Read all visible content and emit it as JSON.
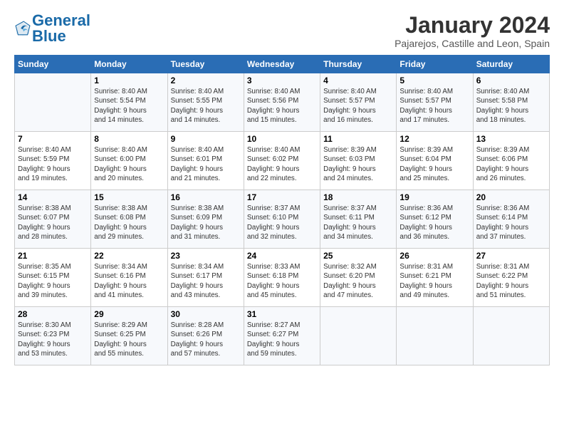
{
  "header": {
    "logo_text_general": "General",
    "logo_text_blue": "Blue",
    "month": "January 2024",
    "location": "Pajarejos, Castille and Leon, Spain"
  },
  "weekdays": [
    "Sunday",
    "Monday",
    "Tuesday",
    "Wednesday",
    "Thursday",
    "Friday",
    "Saturday"
  ],
  "weeks": [
    [
      {
        "day": "",
        "info": ""
      },
      {
        "day": "1",
        "info": "Sunrise: 8:40 AM\nSunset: 5:54 PM\nDaylight: 9 hours\nand 14 minutes."
      },
      {
        "day": "2",
        "info": "Sunrise: 8:40 AM\nSunset: 5:55 PM\nDaylight: 9 hours\nand 14 minutes."
      },
      {
        "day": "3",
        "info": "Sunrise: 8:40 AM\nSunset: 5:56 PM\nDaylight: 9 hours\nand 15 minutes."
      },
      {
        "day": "4",
        "info": "Sunrise: 8:40 AM\nSunset: 5:57 PM\nDaylight: 9 hours\nand 16 minutes."
      },
      {
        "day": "5",
        "info": "Sunrise: 8:40 AM\nSunset: 5:57 PM\nDaylight: 9 hours\nand 17 minutes."
      },
      {
        "day": "6",
        "info": "Sunrise: 8:40 AM\nSunset: 5:58 PM\nDaylight: 9 hours\nand 18 minutes."
      }
    ],
    [
      {
        "day": "7",
        "info": "Sunrise: 8:40 AM\nSunset: 5:59 PM\nDaylight: 9 hours\nand 19 minutes."
      },
      {
        "day": "8",
        "info": "Sunrise: 8:40 AM\nSunset: 6:00 PM\nDaylight: 9 hours\nand 20 minutes."
      },
      {
        "day": "9",
        "info": "Sunrise: 8:40 AM\nSunset: 6:01 PM\nDaylight: 9 hours\nand 21 minutes."
      },
      {
        "day": "10",
        "info": "Sunrise: 8:40 AM\nSunset: 6:02 PM\nDaylight: 9 hours\nand 22 minutes."
      },
      {
        "day": "11",
        "info": "Sunrise: 8:39 AM\nSunset: 6:03 PM\nDaylight: 9 hours\nand 24 minutes."
      },
      {
        "day": "12",
        "info": "Sunrise: 8:39 AM\nSunset: 6:04 PM\nDaylight: 9 hours\nand 25 minutes."
      },
      {
        "day": "13",
        "info": "Sunrise: 8:39 AM\nSunset: 6:06 PM\nDaylight: 9 hours\nand 26 minutes."
      }
    ],
    [
      {
        "day": "14",
        "info": "Sunrise: 8:38 AM\nSunset: 6:07 PM\nDaylight: 9 hours\nand 28 minutes."
      },
      {
        "day": "15",
        "info": "Sunrise: 8:38 AM\nSunset: 6:08 PM\nDaylight: 9 hours\nand 29 minutes."
      },
      {
        "day": "16",
        "info": "Sunrise: 8:38 AM\nSunset: 6:09 PM\nDaylight: 9 hours\nand 31 minutes."
      },
      {
        "day": "17",
        "info": "Sunrise: 8:37 AM\nSunset: 6:10 PM\nDaylight: 9 hours\nand 32 minutes."
      },
      {
        "day": "18",
        "info": "Sunrise: 8:37 AM\nSunset: 6:11 PM\nDaylight: 9 hours\nand 34 minutes."
      },
      {
        "day": "19",
        "info": "Sunrise: 8:36 AM\nSunset: 6:12 PM\nDaylight: 9 hours\nand 36 minutes."
      },
      {
        "day": "20",
        "info": "Sunrise: 8:36 AM\nSunset: 6:14 PM\nDaylight: 9 hours\nand 37 minutes."
      }
    ],
    [
      {
        "day": "21",
        "info": "Sunrise: 8:35 AM\nSunset: 6:15 PM\nDaylight: 9 hours\nand 39 minutes."
      },
      {
        "day": "22",
        "info": "Sunrise: 8:34 AM\nSunset: 6:16 PM\nDaylight: 9 hours\nand 41 minutes."
      },
      {
        "day": "23",
        "info": "Sunrise: 8:34 AM\nSunset: 6:17 PM\nDaylight: 9 hours\nand 43 minutes."
      },
      {
        "day": "24",
        "info": "Sunrise: 8:33 AM\nSunset: 6:18 PM\nDaylight: 9 hours\nand 45 minutes."
      },
      {
        "day": "25",
        "info": "Sunrise: 8:32 AM\nSunset: 6:20 PM\nDaylight: 9 hours\nand 47 minutes."
      },
      {
        "day": "26",
        "info": "Sunrise: 8:31 AM\nSunset: 6:21 PM\nDaylight: 9 hours\nand 49 minutes."
      },
      {
        "day": "27",
        "info": "Sunrise: 8:31 AM\nSunset: 6:22 PM\nDaylight: 9 hours\nand 51 minutes."
      }
    ],
    [
      {
        "day": "28",
        "info": "Sunrise: 8:30 AM\nSunset: 6:23 PM\nDaylight: 9 hours\nand 53 minutes."
      },
      {
        "day": "29",
        "info": "Sunrise: 8:29 AM\nSunset: 6:25 PM\nDaylight: 9 hours\nand 55 minutes."
      },
      {
        "day": "30",
        "info": "Sunrise: 8:28 AM\nSunset: 6:26 PM\nDaylight: 9 hours\nand 57 minutes."
      },
      {
        "day": "31",
        "info": "Sunrise: 8:27 AM\nSunset: 6:27 PM\nDaylight: 9 hours\nand 59 minutes."
      },
      {
        "day": "",
        "info": ""
      },
      {
        "day": "",
        "info": ""
      },
      {
        "day": "",
        "info": ""
      }
    ]
  ]
}
